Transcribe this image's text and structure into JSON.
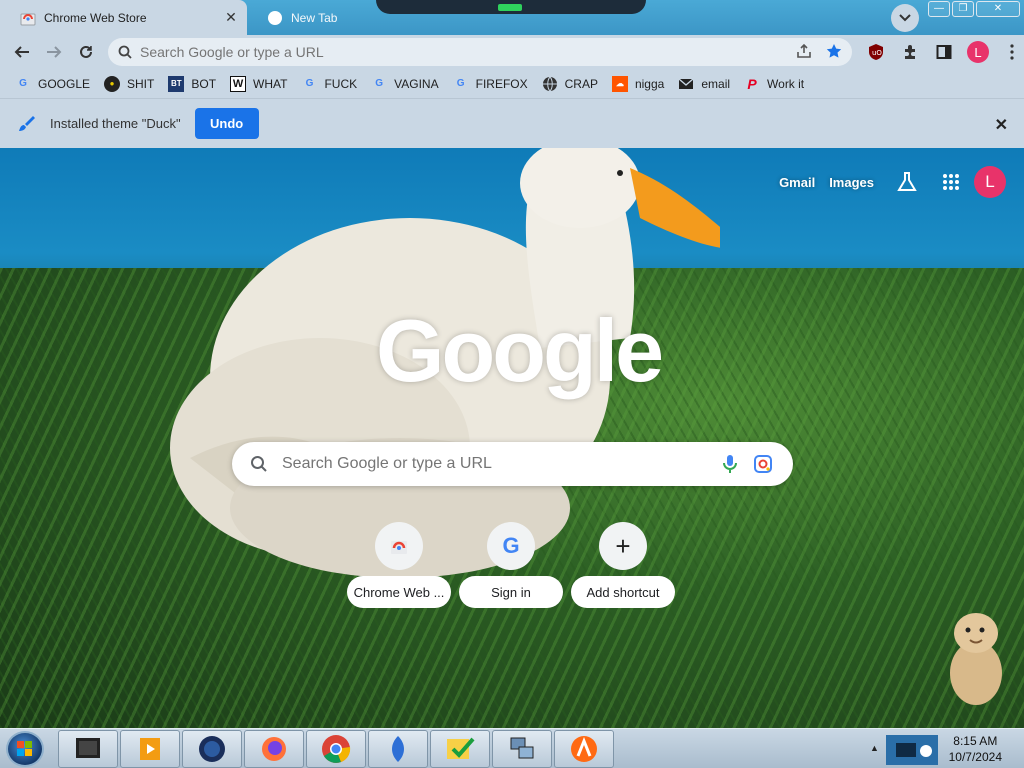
{
  "tabs": [
    {
      "title": "Chrome Web Store",
      "active": true
    },
    {
      "title": "New Tab",
      "active": false
    }
  ],
  "toolbar": {
    "omnibox_placeholder": "Search Google or type a URL"
  },
  "bookmarks": [
    {
      "label": "GOOGLE",
      "icon": "google-icon"
    },
    {
      "label": "SHIT",
      "icon": "site-icon"
    },
    {
      "label": "BOT",
      "icon": "bt-icon"
    },
    {
      "label": "WHAT",
      "icon": "w-icon"
    },
    {
      "label": "FUCK",
      "icon": "google-icon"
    },
    {
      "label": "VAGINA",
      "icon": "google-icon"
    },
    {
      "label": "FIREFOX",
      "icon": "google-icon"
    },
    {
      "label": "CRAP",
      "icon": "globe-icon"
    },
    {
      "label": "nigga",
      "icon": "soundcloud-icon"
    },
    {
      "label": "email",
      "icon": "mail-icon"
    },
    {
      "label": "Work it",
      "icon": "pinterest-icon"
    }
  ],
  "infobar": {
    "message": "Installed theme \"Duck\"",
    "undo_label": "Undo"
  },
  "ntp": {
    "gmail": "Gmail",
    "images": "Images",
    "avatar_letter": "L",
    "logo": "Google",
    "search_placeholder": "Search Google or type a URL",
    "shortcuts": [
      {
        "label": "Chrome Web ...",
        "icon": "chrome-webstore-icon"
      },
      {
        "label": "Sign in",
        "icon": "google-icon"
      },
      {
        "label": "Add shortcut",
        "icon": "plus-icon"
      }
    ]
  },
  "profile": {
    "avatar_letter": "L"
  },
  "taskbar": {
    "time": "8:15 AM",
    "date": "10/7/2024"
  },
  "colors": {
    "accent": "#1a73e8",
    "avatar": "#e8336a",
    "frame": "#c9d7e4"
  }
}
